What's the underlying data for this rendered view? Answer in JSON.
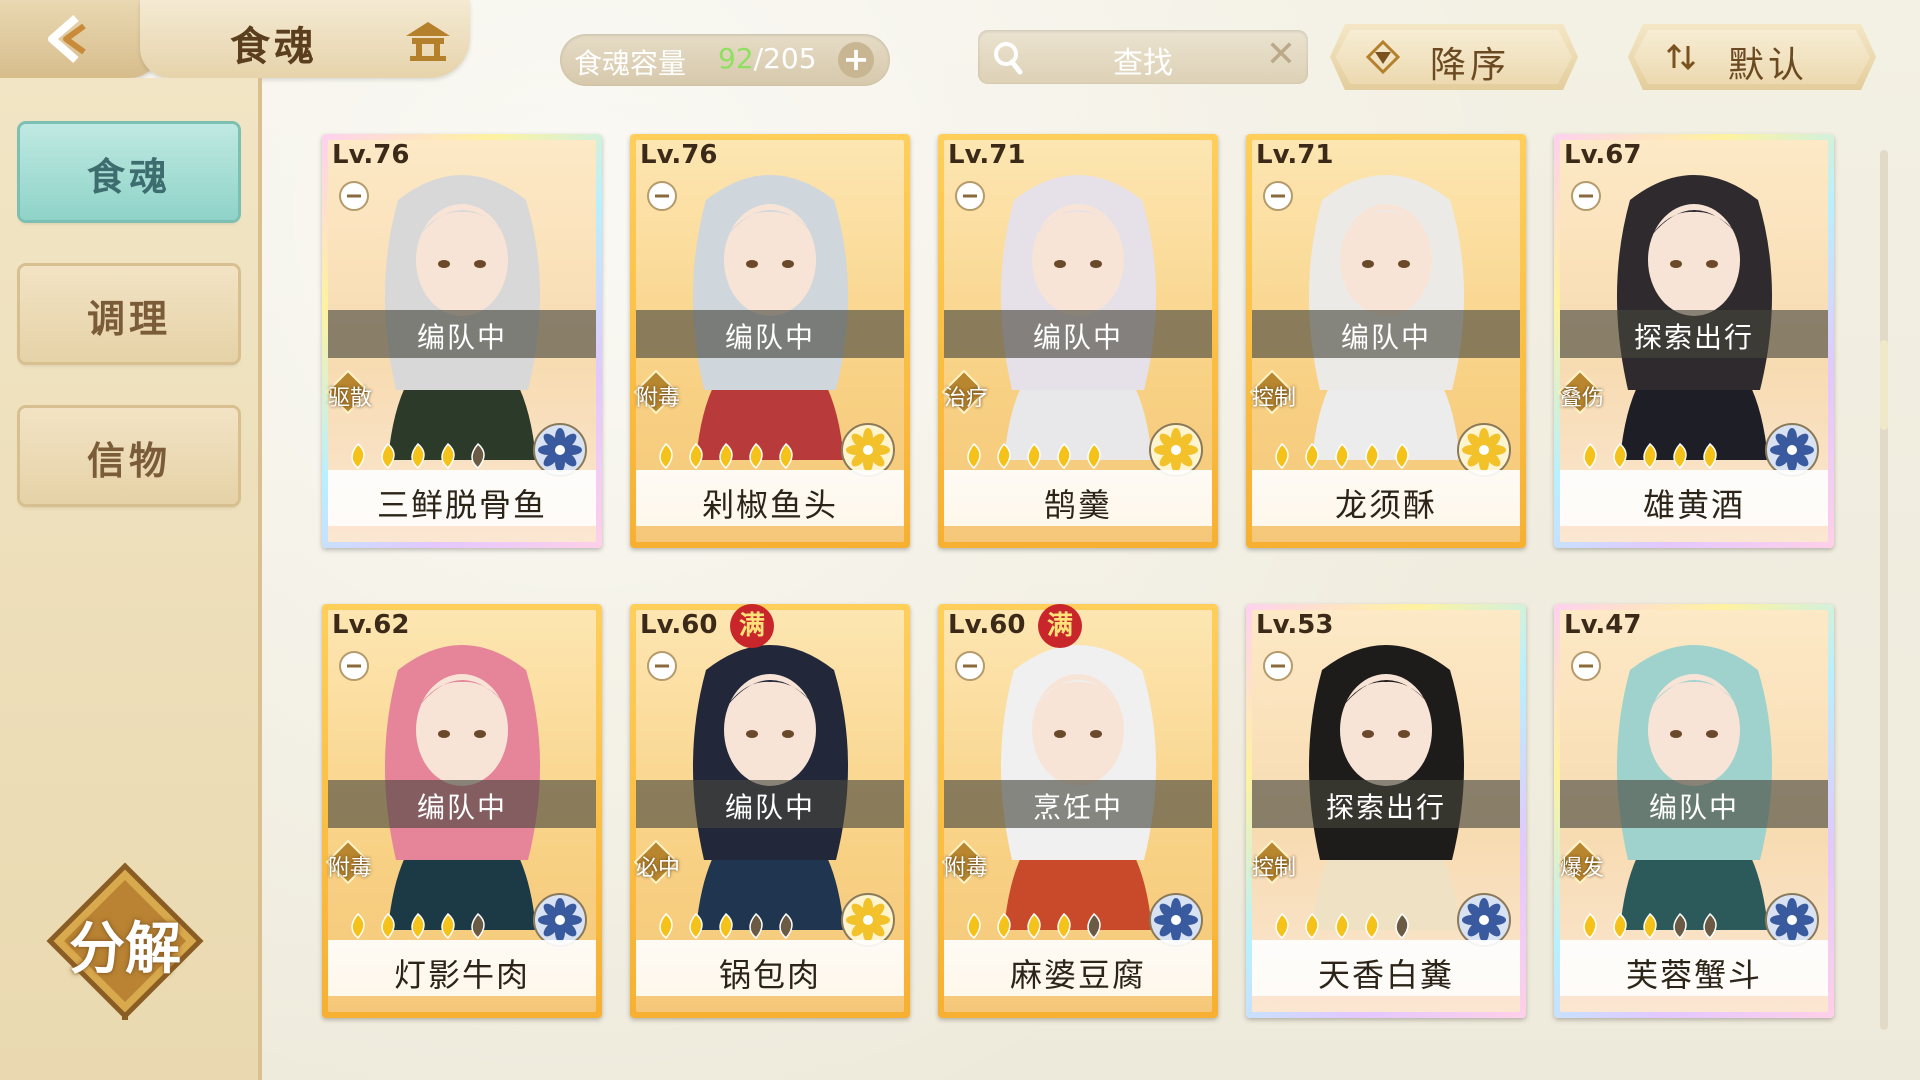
{
  "header": {
    "title": "食魂",
    "capacity_label": "食魂容量",
    "capacity_current": "92",
    "capacity_total": "/205",
    "capacity_add": "+",
    "search_label": "查找",
    "clear_glyph": "✕",
    "sort_order_label": "降序",
    "sort_mode_label": "默认"
  },
  "sidebar": {
    "items": [
      {
        "label": "食魂",
        "active": true
      },
      {
        "label": "调理",
        "active": false
      },
      {
        "label": "信物",
        "active": false
      }
    ],
    "decompose_label": "分解"
  },
  "colors": {
    "accent_teal": "#8fd3c8",
    "gold": "#f7b031",
    "capacity_current": "#8fe060"
  },
  "cards": [
    {
      "level": "Lv.76",
      "status": "编队中",
      "role": "驱散",
      "name": "三鲜脱骨鱼",
      "stars": 4,
      "frame": "rainbow",
      "element": "blue-flower-icon",
      "full": false
    },
    {
      "level": "Lv.76",
      "status": "编队中",
      "role": "附毒",
      "name": "剁椒鱼头",
      "stars": 5,
      "frame": "gold",
      "element": "gold-flower-icon",
      "full": false
    },
    {
      "level": "Lv.71",
      "status": "编队中",
      "role": "治疗",
      "name": "鹄羹",
      "stars": 5,
      "frame": "gold",
      "element": "gold-flower-icon",
      "full": false
    },
    {
      "level": "Lv.71",
      "status": "编队中",
      "role": "控制",
      "name": "龙须酥",
      "stars": 5,
      "frame": "gold",
      "element": "gold-flower-icon",
      "full": false
    },
    {
      "level": "Lv.67",
      "status": "探索出行",
      "role": "叠伤",
      "name": "雄黄酒",
      "stars": 5,
      "frame": "rainbow",
      "element": "blue-flower-icon",
      "full": false
    },
    {
      "level": "Lv.62",
      "status": "编队中",
      "role": "附毒",
      "name": "灯影牛肉",
      "stars": 4,
      "frame": "gold",
      "element": "blue-flower-icon",
      "full": false
    },
    {
      "level": "Lv.60",
      "status": "编队中",
      "role": "必中",
      "name": "锅包肉",
      "stars": 3,
      "frame": "gold",
      "element": "gold-flower-icon",
      "full": true,
      "full_label": "满"
    },
    {
      "level": "Lv.60",
      "status": "烹饪中",
      "role": "附毒",
      "name": "麻婆豆腐",
      "stars": 4,
      "frame": "gold",
      "element": "blue-flower-icon",
      "full": true,
      "full_label": "满"
    },
    {
      "level": "Lv.53",
      "status": "探索出行",
      "role": "控制",
      "name": "天香白糞",
      "stars": 4,
      "frame": "rainbow",
      "element": "blue-flower-icon",
      "full": false
    },
    {
      "level": "Lv.47",
      "status": "编队中",
      "role": "爆发",
      "name": "芙蓉蟹斗",
      "stars": 3,
      "frame": "rainbow",
      "element": "blue-flower-icon",
      "full": false
    }
  ]
}
